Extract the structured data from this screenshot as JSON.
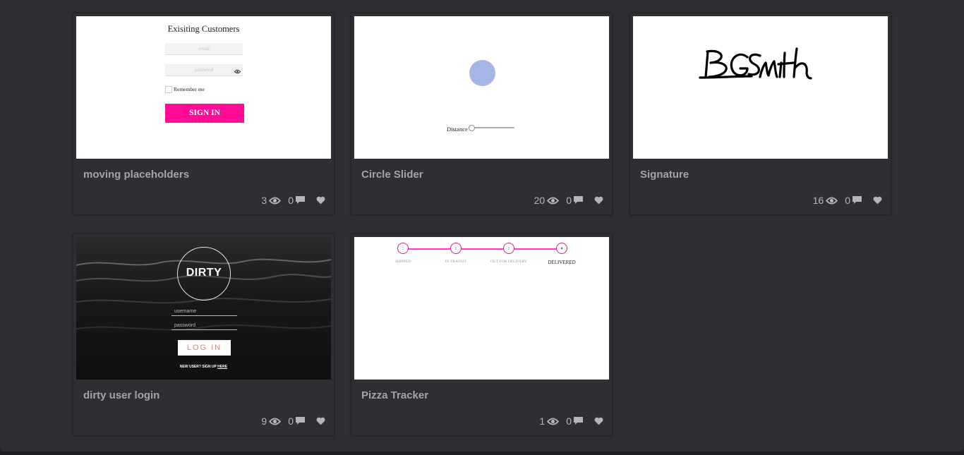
{
  "cards": [
    {
      "title": "moving placeholders",
      "views": "3",
      "comments": "0",
      "preview": {
        "heading": "Exisiting Customers",
        "email_placeholder": "email",
        "password_placeholder": "password",
        "remember_label": "Remember me",
        "button_label": "SIGN IN"
      }
    },
    {
      "title": "Circle Slider",
      "views": "20",
      "comments": "0",
      "preview": {
        "slider_label": "Distance",
        "circle_color": "#a7b4e6"
      }
    },
    {
      "title": "Signature",
      "views": "16",
      "comments": "0",
      "preview": {
        "signature_text": "BGSmith"
      }
    },
    {
      "title": "dirty user login",
      "views": "9",
      "comments": "0",
      "preview": {
        "logo": "DIRTY",
        "username_placeholder": "username",
        "password_placeholder": "password",
        "button_label": "LOG IN",
        "signup_text": "NEW USER? SIGN UP",
        "signup_link": "HERE"
      }
    },
    {
      "title": "Pizza Tracker",
      "views": "1",
      "comments": "0",
      "preview": {
        "steps": [
          {
            "number": "1",
            "label": "SHIPPED"
          },
          {
            "number": "2",
            "label": "IN TRANSIT"
          },
          {
            "number": "3",
            "label": "OUT FOR DELIVERY"
          },
          {
            "number": "4",
            "label": "DELIVERED"
          }
        ],
        "accent_color": "#ff3fbf"
      }
    }
  ],
  "colors": {
    "background": "#2f2f33",
    "title": "#a3a3a9",
    "signin_button": "#ff0b95"
  }
}
